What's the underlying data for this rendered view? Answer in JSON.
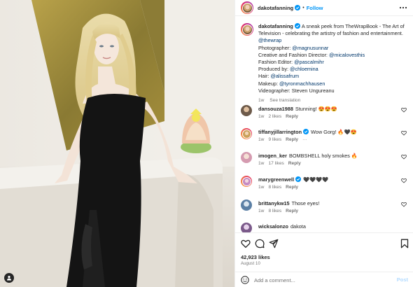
{
  "post": {
    "author": "dakotafanning",
    "follow_label": "Follow",
    "separator": "•",
    "caption_lines": [
      {
        "text": "A sneak peek from TheWrapBook - The Art of"
      },
      {
        "text": "Television - celebrating the artistry of fashion and entertainment."
      },
      {
        "link": "@thewrap"
      },
      {
        "text": "Photographer: ",
        "link": "@magnusunnar"
      },
      {
        "text": "Creative and Fashion Director: ",
        "link": "@micalovesthis"
      },
      {
        "text": "Fashion Editor: ",
        "link": "@pascalmihr"
      },
      {
        "text": "Produced by: ",
        "link": "@chloemina"
      },
      {
        "text": "Hair: ",
        "link": "@alissafrum"
      },
      {
        "text": "Makeup: ",
        "link": "@tyronmachhausen"
      },
      {
        "text": "Videographer: Steven Ungureanu"
      }
    ],
    "caption_time": "1w",
    "see_translation": "See translation",
    "likes": "42,923 likes",
    "date": "August 10",
    "add_comment_placeholder": "Add a comment...",
    "post_label": "Post"
  },
  "comments": [
    {
      "user": "dansouza1988",
      "verified": false,
      "text": "Stunning! 😍😍😍",
      "time": "1w",
      "likes": "2 likes",
      "reply": "Reply",
      "extra": "",
      "avatar_color": "#6d5a4a"
    },
    {
      "user": "tiffanyjillarrington",
      "verified": true,
      "text": "Wow Gorg! 🔥🖤😍",
      "time": "1w",
      "likes": "9 likes",
      "reply": "Reply",
      "extra": "···",
      "avatar_color": "#caa05a"
    },
    {
      "user": "imogen_ker",
      "verified": false,
      "text": "BOMBSHELL holy smokes 🔥",
      "time": "1w",
      "likes": "17 likes",
      "reply": "Reply",
      "extra": "",
      "avatar_color": "#d59bb0"
    },
    {
      "user": "marygreenwell",
      "verified": true,
      "text": "🖤🖤🖤🖤",
      "time": "1w",
      "likes": "8 likes",
      "reply": "Reply",
      "extra": "",
      "avatar_color": "#c58bc2"
    },
    {
      "user": "brittanykw15",
      "verified": false,
      "text": "Those eyes!",
      "time": "1w",
      "likes": "8 likes",
      "reply": "Reply",
      "extra": "",
      "avatar_color": "#5b7fa5"
    },
    {
      "user": "wicksalonzo",
      "verified": false,
      "text": "dakota",
      "time": "",
      "likes": "",
      "reply": "",
      "extra": "",
      "avatar_color": "#7b5a8a"
    }
  ],
  "colors": {
    "follow": "#0095f6",
    "link": "#00376b",
    "muted": "#737373",
    "verified": "#0095f6"
  },
  "icons": [
    "more-options-icon",
    "heart-icon",
    "comment-icon",
    "share-icon",
    "bookmark-icon",
    "emoji-icon",
    "user-icon",
    "verified-icon"
  ]
}
